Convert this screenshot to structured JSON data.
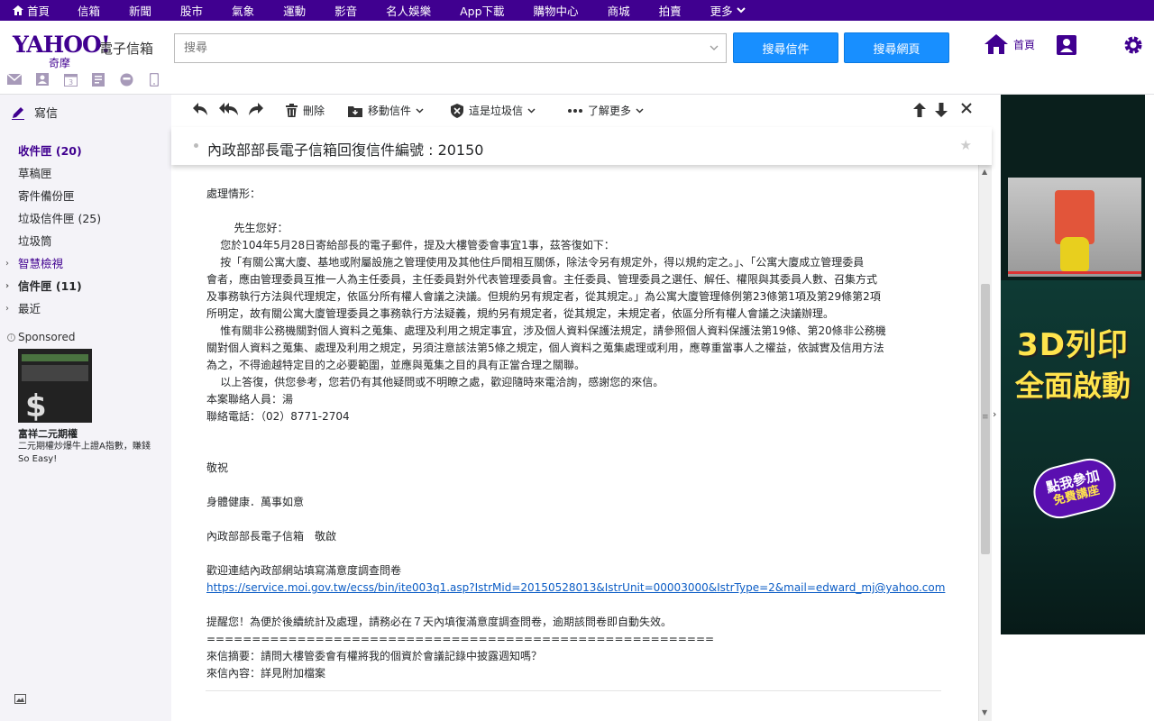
{
  "topnav": {
    "items": [
      "首頁",
      "信箱",
      "新聞",
      "股市",
      "氣象",
      "運動",
      "影音",
      "名人娛樂",
      "App下載",
      "購物中心",
      "商城",
      "拍賣",
      "更多"
    ]
  },
  "header": {
    "logo_brand": "YAHOO!",
    "logo_cn": "奇摩",
    "logo_product": "電子信箱",
    "search_placeholder": "搜尋",
    "btn_search_mail": "搜尋信件",
    "btn_search_web": "搜尋網頁",
    "home_label": "首頁"
  },
  "sidebar": {
    "compose": "寫信",
    "folders": [
      {
        "label": "收件匣 (20)"
      },
      {
        "label": "草稿匣"
      },
      {
        "label": "寄件備份匣"
      },
      {
        "label": "垃圾信件匣 (25)"
      },
      {
        "label": "垃圾筒"
      },
      {
        "label": "智慧檢視"
      },
      {
        "label": "信件匣 (11)"
      },
      {
        "label": "最近"
      }
    ],
    "sponsored_label": "Sponsored",
    "ad_title": "富祥二元期權",
    "ad_desc": "二元期權炒爆牛上證A指數，賺錢So Easy!"
  },
  "toolbar": {
    "delete": "刪除",
    "move": "移動信件",
    "spam": "這是垃圾信",
    "more": "了解更多"
  },
  "message": {
    "subject": "內政部部長電子信箱回復信件編號 : 20150",
    "lines": [
      "處理情形：",
      "",
      "        先生您好：",
      "    您於104年5月28日寄給部長的電子郵件，提及大樓管委會事宜1事，茲答復如下：",
      "    按「有關公寓大廈、基地或附屬設施之管理使用及其他住戶間相互關係，除法令另有規定外，得以規約定之。」、「公寓大廈成立管理委員",
      "會者，應由管理委員互推一人為主任委員，主任委員對外代表管理委員會。主任委員、管理委員之選任、解任、權限與其委員人數、召集方式",
      "及事務執行方法與代理規定，依區分所有權人會議之決議。但規約另有規定者，從其規定。」為公寓大廈管理條例第23條第1項及第29條第2項",
      "所明定，故有關公寓大廈管理委員之事務執行方法疑義，規約另有規定者，從其規定，未規定者，依區分所有權人會議之決議辦理。",
      "    惟有關非公務機關對個人資料之蒐集、處理及利用之規定事宜，涉及個人資料保護法規定，請參照個人資料保護法第19條、第20條非公務機",
      "關對個人資料之蒐集、處理及利用之規定，另須注意該法第5條之規定，個人資料之蒐集處理或利用，應尊重當事人之權益，依誠實及信用方法",
      "為之，不得逾越特定目的之必要範圍，並應與蒐集之目的具有正當合理之關聯。",
      "    以上答復，供您參考，您若仍有其他疑問或不明瞭之處，歡迎隨時來電洽詢，感謝您的來信。",
      "本案聯絡人員：湯",
      "聯絡電話：（02）8771-2704",
      "",
      "",
      "敬祝",
      "",
      "身體健康．萬事如意",
      "",
      "內政部部長電子信箱　敬啟",
      "",
      "歡迎連結內政部網站填寫滿意度調查問卷"
    ],
    "survey_link": "https://service.moi.gov.tw/ecss/bin/ite003q1.asp?IstrMid=20150528013&IstrUnit=00003000&IstrType=2&mail=edward_mj@yahoo.com",
    "lines_after": [
      "",
      "提醒您！為便於後續統計及處理，請務必在７天內填復滿意度調查問卷，逾期該問卷即自動失效。",
      "========================================================",
      "來信摘要：請問大樓管委會有權將我的個資於會議記錄中披露週知嗎？",
      "來信內容：詳見附加檔案"
    ]
  },
  "right_ad": {
    "headline1": "3D列印",
    "headline2": "全面啟動",
    "cta1": "點我參加",
    "cta2": "免費講座"
  },
  "colors": {
    "brand_purple": "#400090",
    "button_blue": "#188fff",
    "link_blue": "#0b5cc5"
  }
}
